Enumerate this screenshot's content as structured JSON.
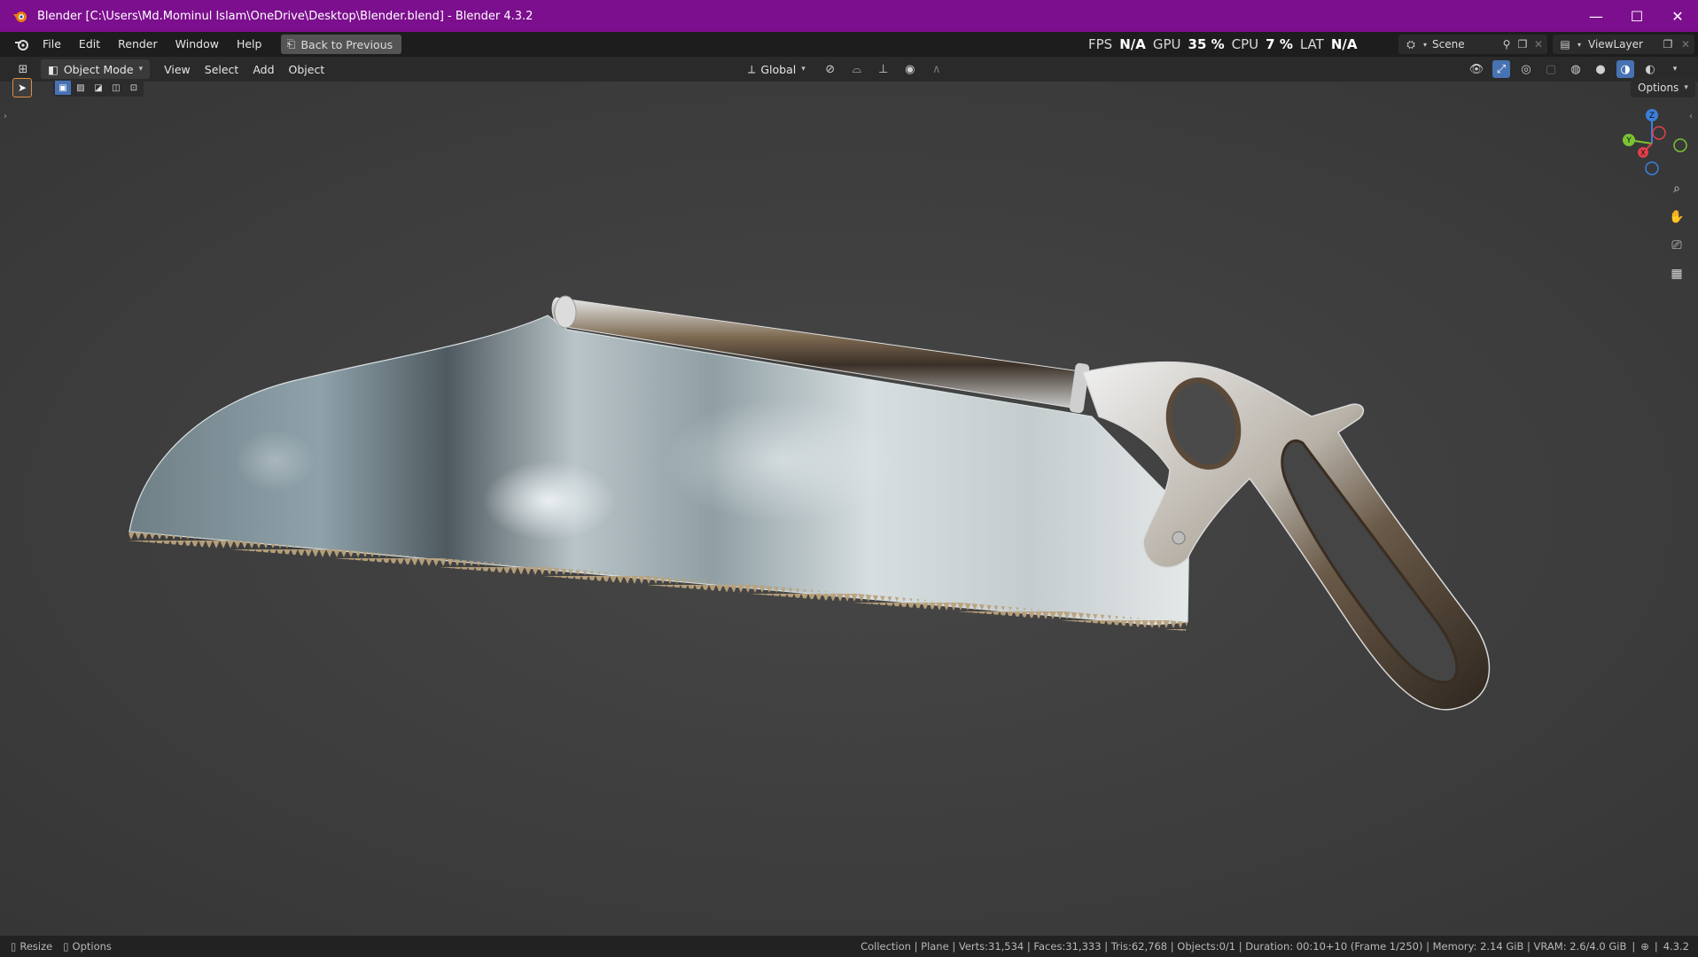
{
  "window": {
    "title": "Blender [C:\\Users\\Md.Mominul Islam\\OneDrive\\Desktop\\Blender.blend] - Blender 4.3.2",
    "controls": [
      "—",
      "☐",
      "✕"
    ]
  },
  "menubar": {
    "items": [
      "File",
      "Edit",
      "Render",
      "Window",
      "Help"
    ],
    "back_button": "Back to Previous"
  },
  "perf_stats": {
    "fps_label": "FPS",
    "fps_value": "N/A",
    "gpu_label": "GPU",
    "gpu_value": "35 %",
    "cpu_label": "CPU",
    "cpu_value": "7 %",
    "lat_label": "LAT",
    "lat_value": "N/A"
  },
  "scene": {
    "name": "Scene"
  },
  "view_layer": {
    "name": "ViewLayer"
  },
  "viewport_header": {
    "mode": "Object Mode",
    "menus": [
      "View",
      "Select",
      "Add",
      "Object"
    ],
    "transform_orientation": "Global",
    "options_label": "Options"
  },
  "gizmo": {
    "axes": [
      "Z",
      "Y",
      "X"
    ]
  },
  "statusbar": {
    "left": [
      "Resize",
      "Options"
    ],
    "info": "Collection | Plane | Verts:31,534 | Faces:31,333 | Tris:62,768 | Objects:0/1 | Duration: 00:10+10 (Frame 1/250) | Memory: 2.14 GiB | VRAM: 2.6/4.0 GiB",
    "version": "4.3.2"
  },
  "colors": {
    "titlebar": "#7c0f8e",
    "accent_blue": "#4772b3",
    "axis_x": "#e0404a",
    "axis_y": "#7ac332",
    "axis_z": "#3b7fdc"
  }
}
